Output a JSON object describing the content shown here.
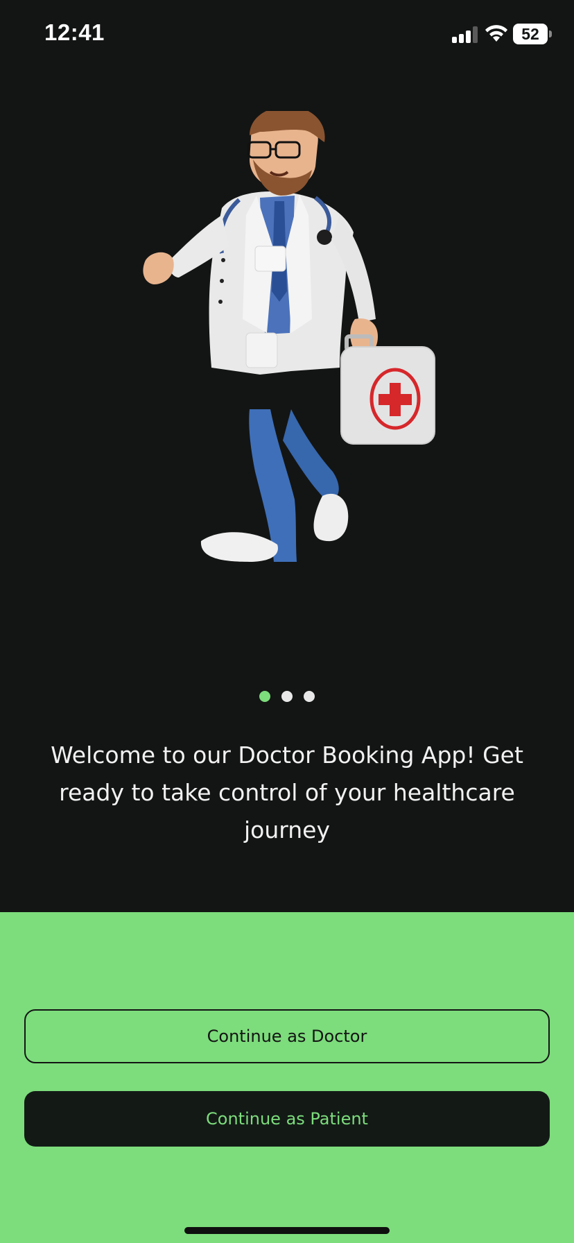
{
  "status_bar": {
    "time": "12:41",
    "battery": "52",
    "icons": [
      "cellular-signal-icon",
      "wifi-icon",
      "battery-icon"
    ]
  },
  "onboarding": {
    "illustration": "doctor-with-first-aid-kit-illustration",
    "pagination": {
      "total": 3,
      "active": 1
    },
    "message": "Welcome to our Doctor Booking App! Get ready to take control of your healthcare journey"
  },
  "actions": {
    "doctor_label": "Continue as Doctor",
    "patient_label": "Continue as Patient"
  },
  "colors": {
    "background_dark": "#131514",
    "accent_green": "#7ddc7c",
    "button_dark": "#131a16",
    "text_light": "#f2f2f2"
  }
}
